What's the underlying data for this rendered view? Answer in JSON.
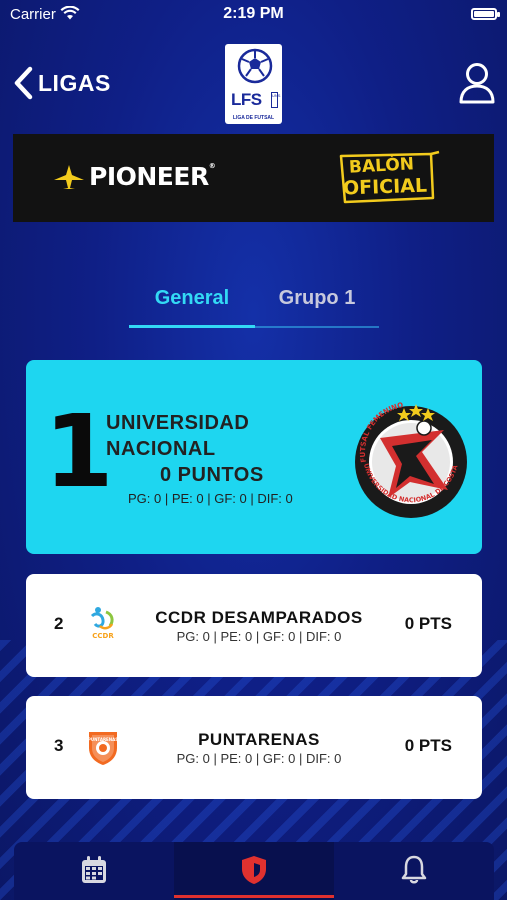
{
  "status_bar": {
    "carrier": "Carrier",
    "time": "2:19 PM"
  },
  "header": {
    "back_label": "LIGAS",
    "logo": {
      "text": "LFS",
      "subtitle": "LIGA DE FUTSAL",
      "side_mark": "UNS"
    }
  },
  "banner": {
    "brand": "PIONEER",
    "brand_mark": "®",
    "badge_line1": "BALÓN",
    "badge_line2": "OFICIAL"
  },
  "tabs": [
    {
      "label": "General",
      "active": true
    },
    {
      "label": "Grupo 1",
      "active": false
    }
  ],
  "standings": {
    "first": {
      "rank": "1",
      "team": "UNIVERSIDAD NACIONAL",
      "points": "0 PUNTOS",
      "stats": "PG: 0 | PE: 0 | GF: 0 | DIF: 0",
      "logo_ring_text": "UNIVERSIDAD NACIONAL DE COSTA RICA",
      "logo_ring_top": "FUTSAL FEMENINO",
      "accent": "#1ed6f0"
    },
    "rest": [
      {
        "rank": "2",
        "team": "CCDR DESAMPARADOS",
        "stats": "PG: 0 | PE: 0 | GF: 0 | DIF: 0",
        "points": "0 PTS",
        "logo_text": "CCDR"
      },
      {
        "rank": "3",
        "team": "PUNTARENAS",
        "stats": "PG: 0 | PE: 0 | GF: 0 | DIF: 0",
        "points": "0 PTS",
        "logo_text": "PUNTARENAS"
      }
    ]
  },
  "tabbar": {
    "items": [
      {
        "icon": "calendar-icon",
        "active": false
      },
      {
        "icon": "shield-icon",
        "active": true
      },
      {
        "icon": "bell-icon",
        "active": false
      }
    ],
    "active_color": "#e0312f"
  },
  "colors": {
    "background": "#0f1e7a",
    "tab_active": "#33d9f5",
    "tab_inactive": "#c7c9dd"
  }
}
